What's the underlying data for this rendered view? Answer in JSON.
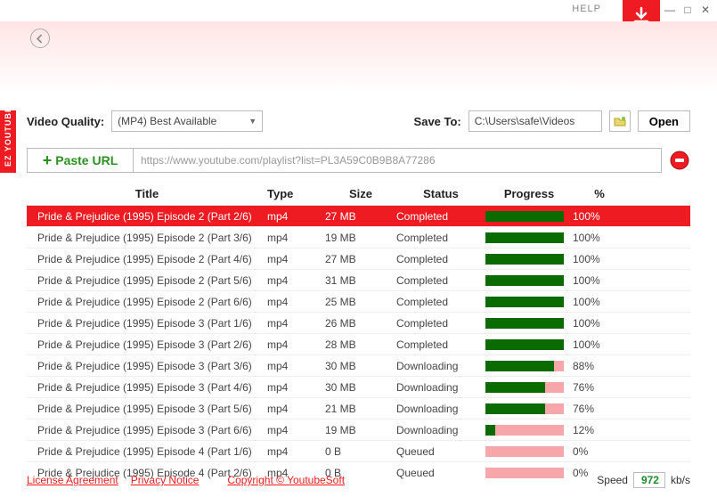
{
  "sidebar_label": "EZ YOUTUBE DOWNLOADER FREE",
  "help_label": "HELP",
  "video_quality_label": "Video Quality:",
  "video_quality_value": "(MP4) Best Available",
  "save_to_label": "Save To:",
  "save_to_path": "C:\\Users\\safe\\Videos",
  "open_label": "Open",
  "paste_url_label": "Paste URL",
  "url_placeholder": "https://www.youtube.com/playlist?list=PL3A59C0B9B8A77286",
  "headers": {
    "title": "Title",
    "type": "Type",
    "size": "Size",
    "status": "Status",
    "progress": "Progress",
    "pct": "%"
  },
  "rows": [
    {
      "title": "Pride & Prejudice (1995) Episode 2 (Part 2/6)",
      "type": "mp4",
      "size": "27 MB",
      "status": "Completed",
      "pct": 100,
      "sel": true
    },
    {
      "title": "Pride & Prejudice (1995) Episode 2 (Part 3/6)",
      "type": "mp4",
      "size": "19 MB",
      "status": "Completed",
      "pct": 100
    },
    {
      "title": "Pride & Prejudice (1995) Episode 2 (Part 4/6)",
      "type": "mp4",
      "size": "27 MB",
      "status": "Completed",
      "pct": 100
    },
    {
      "title": "Pride & Prejudice (1995) Episode 2 (Part 5/6)",
      "type": "mp4",
      "size": "31 MB",
      "status": "Completed",
      "pct": 100
    },
    {
      "title": "Pride & Prejudice (1995) Episode 2 (Part 6/6)",
      "type": "mp4",
      "size": "25 MB",
      "status": "Completed",
      "pct": 100
    },
    {
      "title": "Pride & Prejudice (1995) Episode 3 (Part 1/6)",
      "type": "mp4",
      "size": "26 MB",
      "status": "Completed",
      "pct": 100
    },
    {
      "title": "Pride & Prejudice (1995) Episode 3 (Part 2/6)",
      "type": "mp4",
      "size": "28 MB",
      "status": "Completed",
      "pct": 100
    },
    {
      "title": "Pride & Prejudice (1995) Episode 3 (Part 3/6)",
      "type": "mp4",
      "size": "30 MB",
      "status": "Downloading",
      "pct": 88
    },
    {
      "title": "Pride & Prejudice (1995) Episode 3 (Part 4/6)",
      "type": "mp4",
      "size": "30 MB",
      "status": "Downloading",
      "pct": 76
    },
    {
      "title": "Pride & Prejudice (1995) Episode 3 (Part 5/6)",
      "type": "mp4",
      "size": "21 MB",
      "status": "Downloading",
      "pct": 76
    },
    {
      "title": "Pride & Prejudice (1995) Episode 3 (Part 6/6)",
      "type": "mp4",
      "size": "19 MB",
      "status": "Downloading",
      "pct": 12
    },
    {
      "title": "Pride & Prejudice (1995) Episode 4 (Part 1/6)",
      "type": "mp4",
      "size": "0 B",
      "status": "Queued",
      "pct": 0
    },
    {
      "title": "Pride & Prejudice (1995) Episode 4 (Part 2/6)",
      "type": "mp4",
      "size": "0 B",
      "status": "Queued",
      "pct": 0
    }
  ],
  "footer": {
    "license": "License Agreement",
    "privacy": "Privacy Notice",
    "copyright": "Copyright © YoutubeSoft",
    "speed_label": "Speed",
    "speed_value": "972",
    "speed_unit": "kb/s"
  }
}
